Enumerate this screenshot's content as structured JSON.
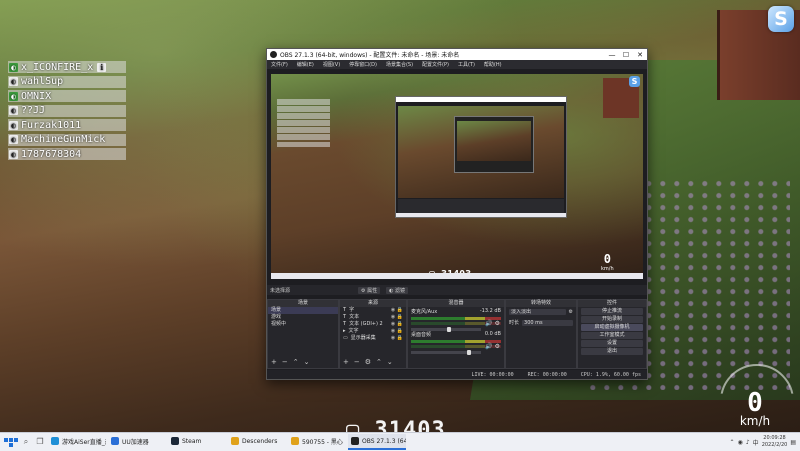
{
  "game": {
    "players": [
      {
        "name": "x_ICONFIRE_x",
        "badge": "ℹ",
        "green": true
      },
      {
        "name": "wahlSup",
        "badge": "",
        "green": false
      },
      {
        "name": "OMNIX",
        "badge": "",
        "green": true
      },
      {
        "name": "??JJ",
        "badge": "",
        "green": false
      },
      {
        "name": "Furzak1011",
        "badge": "",
        "green": false
      },
      {
        "name": "MachineGunMick",
        "badge": "",
        "green": false
      },
      {
        "name": "1787678304",
        "badge": "",
        "green": false
      }
    ],
    "score": "31403",
    "speed_value": "0",
    "speed_unit": "km/h",
    "logo_letter": "S"
  },
  "obs": {
    "title": "OBS 27.1.3 (64-bit, windows) - 配置文件: 未命名 - 场景: 未命名",
    "menu": [
      "文件(F)",
      "编辑(E)",
      "视图(V)",
      "停靠窗口(D)",
      "场景集合(S)",
      "配置文件(P)",
      "工具(T)",
      "帮助(H)"
    ],
    "scene_bar_label": "未选择源",
    "props_button": "⚙ 属性",
    "filters_button": "◐ 滤镜",
    "preview_score": "31403",
    "preview_speed": "0",
    "preview_speed_unit": "km/h",
    "scenes": {
      "title": "场景",
      "items": [
        "场景",
        "游戏",
        "视频中"
      ],
      "selected_index": 0
    },
    "sources": {
      "title": "来源",
      "items": [
        {
          "icon": "T",
          "label": "字"
        },
        {
          "icon": "T",
          "label": "文本"
        },
        {
          "icon": "T",
          "label": "文本 (GDI+) 2"
        },
        {
          "icon": "▸",
          "label": "文字"
        },
        {
          "icon": "▭",
          "label": "显示器采集"
        }
      ]
    },
    "mixer": {
      "title": "混音器",
      "channels": [
        {
          "name": "麦克风/Aux",
          "level": "-13.2 dB",
          "fader": 0.55
        },
        {
          "name": "桌面音频",
          "level": "0.0 dB",
          "fader": 0.85
        }
      ]
    },
    "transitions": {
      "title": "转场特效",
      "effect": "淡入淡出",
      "duration_label": "时长",
      "duration": "300 ms"
    },
    "controls": {
      "title": "控件",
      "buttons": [
        "停止推流",
        "开始录制",
        "启动虚拟摄像机",
        "工作室模式",
        "设置",
        "退出"
      ],
      "active_index": 2
    },
    "status": {
      "live": "LIVE: 00:00:00",
      "rec": "REC: 00:00:00",
      "cpu": "CPU: 1.9%, 60.00 fps"
    }
  },
  "taskbar": {
    "items": [
      {
        "label": "游戏AiSer直播_热...",
        "color": "#1f8fd6",
        "active": false
      },
      {
        "label": "UU加速器",
        "color": "#2b6fd6",
        "active": false
      },
      {
        "label": "Steam",
        "color": "#1b2838",
        "active": false
      },
      {
        "label": "Descenders",
        "color": "#e0a21b",
        "active": false
      },
      {
        "label": "590755 - 黑心",
        "color": "#e0a21b",
        "active": false
      },
      {
        "label": "OBS 27.1.3 (64-bi...",
        "color": "#222222",
        "active": true
      }
    ],
    "time": "20:09:28",
    "date": "2022/2/20"
  }
}
